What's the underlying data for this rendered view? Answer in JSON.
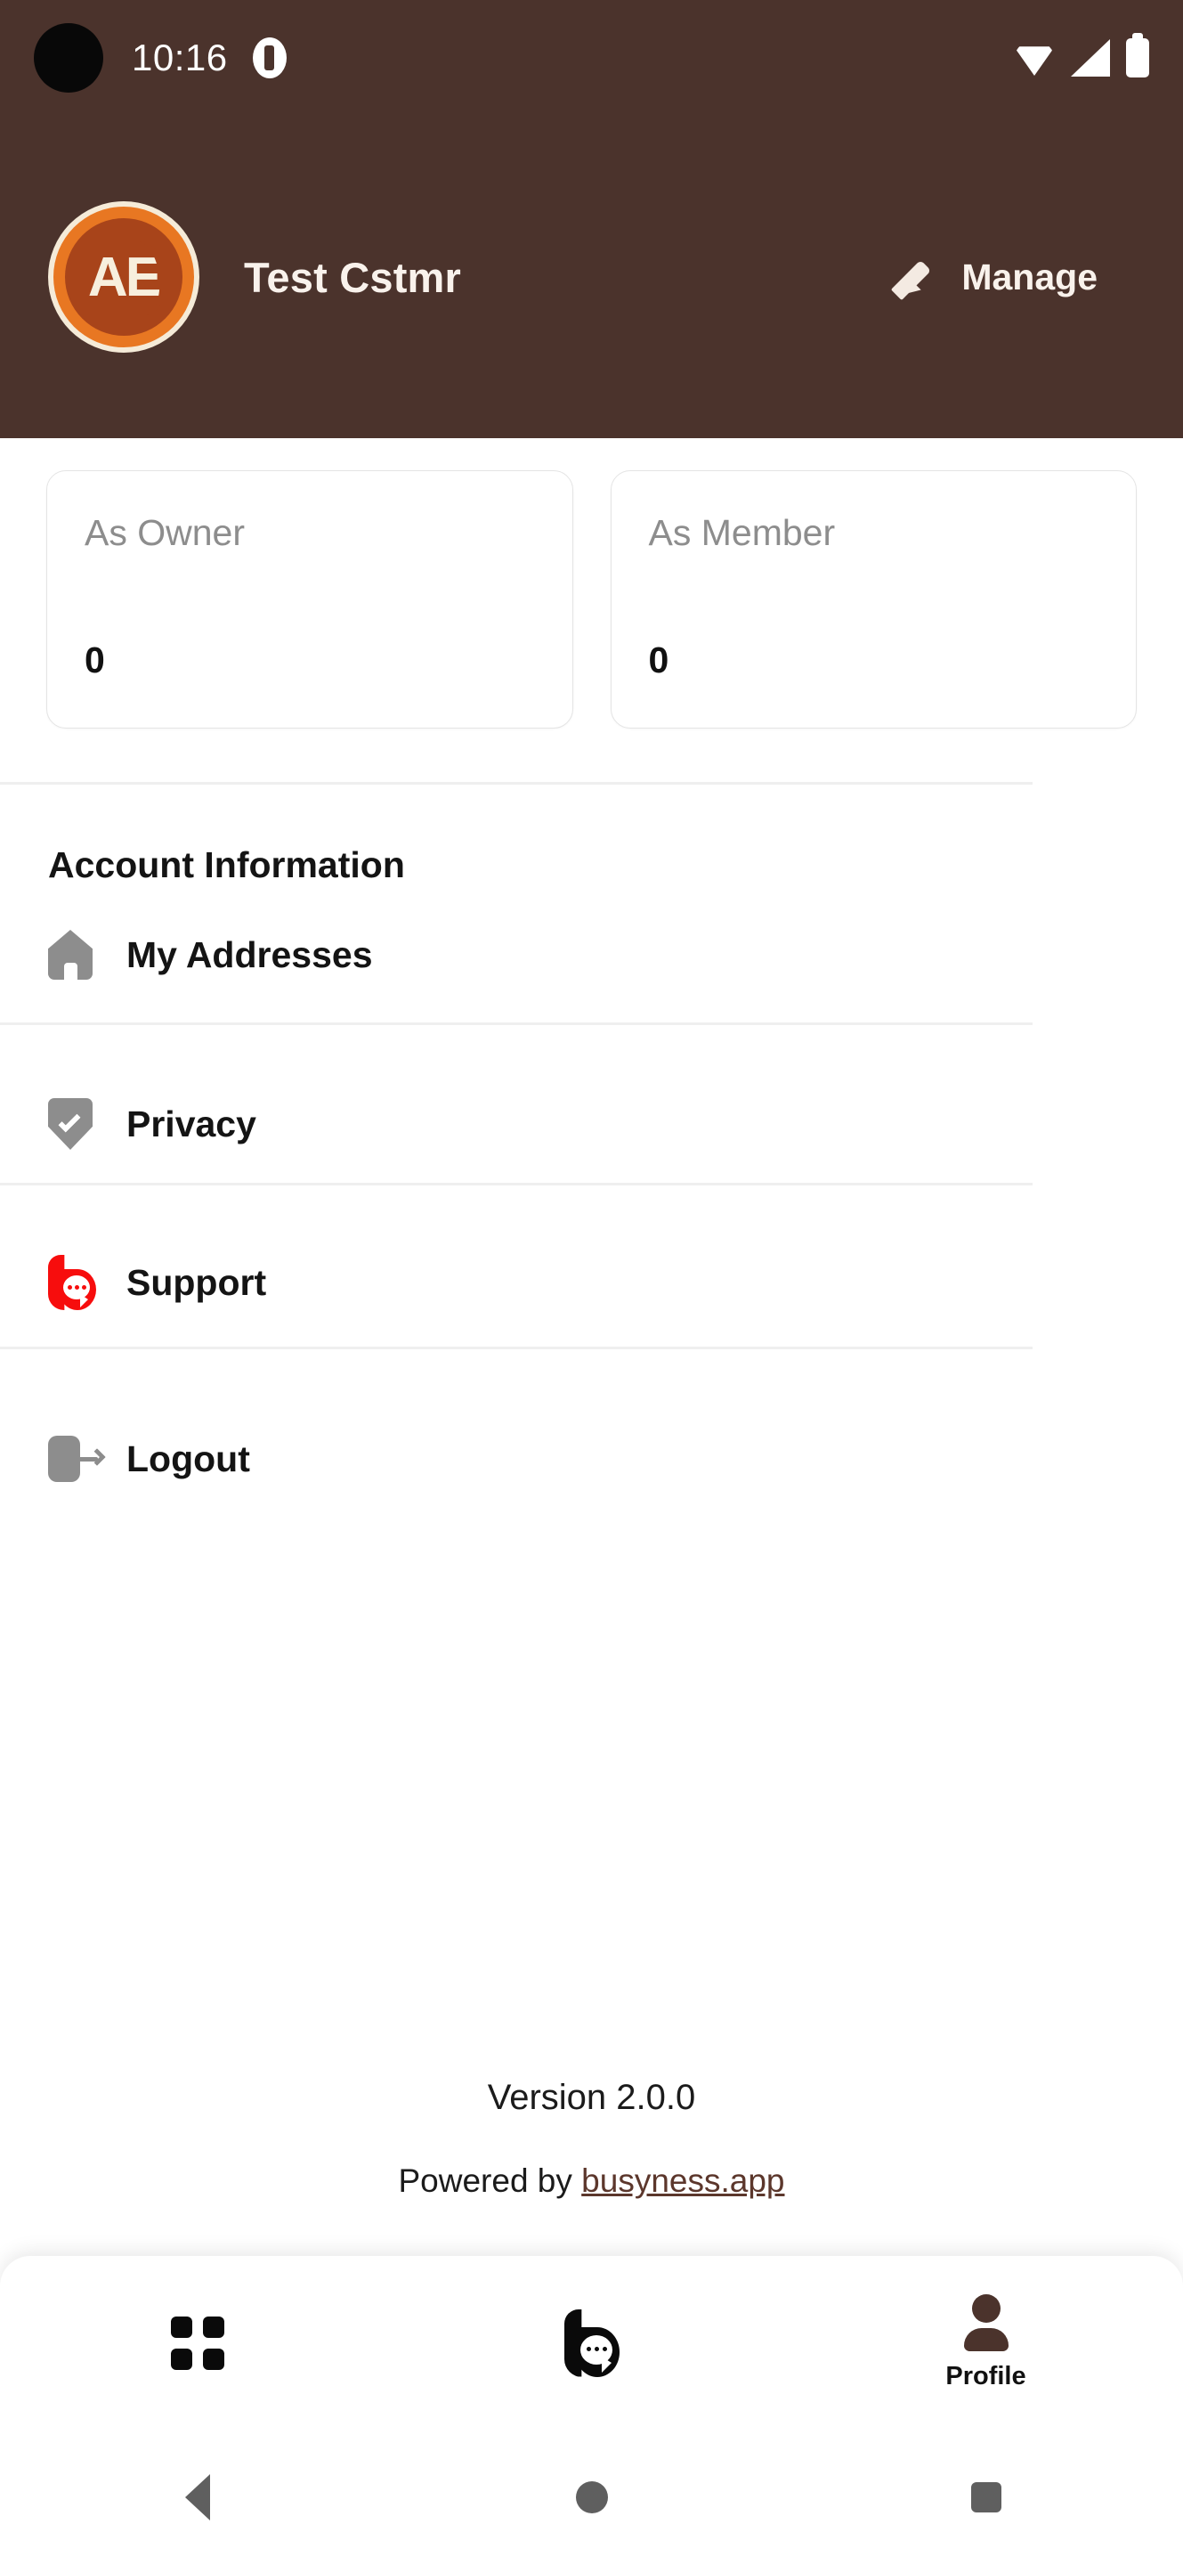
{
  "status_bar": {
    "time": "10:16",
    "icons": [
      "notification-badge-icon",
      "wifi-icon",
      "cellular-signal-icon",
      "battery-icon"
    ]
  },
  "header": {
    "avatar_initials": "AE",
    "title": "Test Cstmr",
    "manage_label": "Manage",
    "bg_color": "#4B332C",
    "accent_color": "#E87722"
  },
  "stats": [
    {
      "label": "As Owner",
      "value": "0"
    },
    {
      "label": "As Member",
      "value": "0"
    }
  ],
  "account_section": {
    "title": "Account Information",
    "items": [
      {
        "label": "My Addresses",
        "icon": "home-icon"
      },
      {
        "label": "Privacy",
        "icon": "shield-check-icon"
      },
      {
        "label": "Support",
        "icon": "busyness-chat-icon"
      },
      {
        "label": "Logout",
        "icon": "logout-icon"
      }
    ]
  },
  "footer": {
    "version": "Version 2.0.0",
    "powered_prefix": "Powered by ",
    "powered_link": "busyness.app",
    "link_color": "#5C372C"
  },
  "bottom_nav": {
    "tabs": [
      {
        "label": "",
        "icon": "grid-icon",
        "active": false
      },
      {
        "label": "",
        "icon": "busyness-b-icon",
        "active": false
      },
      {
        "label": "Profile",
        "icon": "person-icon",
        "active": true
      }
    ]
  },
  "android_nav": {
    "back": "back-icon",
    "home": "home-circle-icon",
    "recents": "recents-square-icon"
  }
}
